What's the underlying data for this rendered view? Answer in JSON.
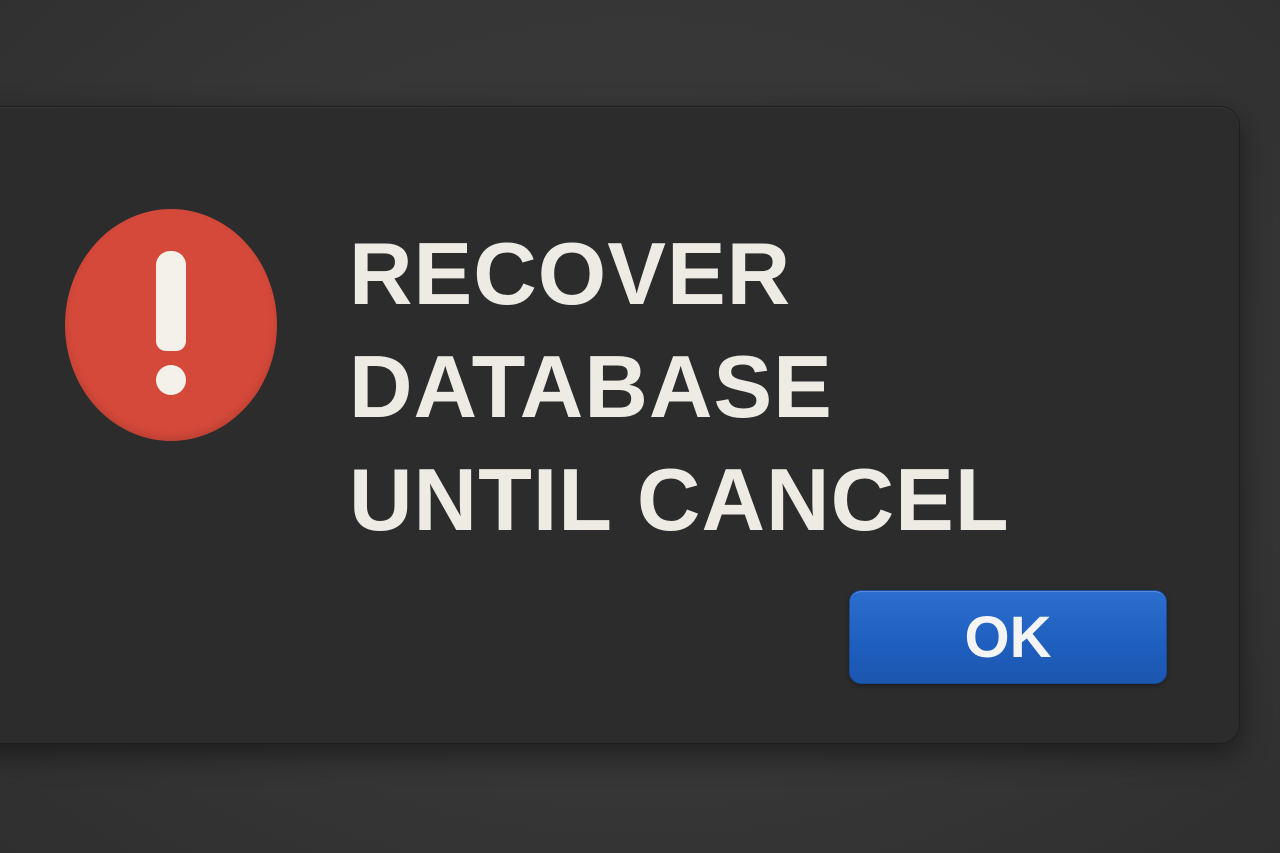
{
  "dialog": {
    "icon": "exclamation-alert-icon",
    "message_lines": [
      "RECOVER",
      "DATABASE",
      "UNTIL CANCEL"
    ],
    "ok_label": "OK"
  },
  "colors": {
    "background": "#3a3a3a",
    "dialog_background": "#2c2c2c",
    "alert_icon": "#d5493a",
    "message_text": "#eeebe4",
    "ok_button": "#1f5fbf"
  }
}
